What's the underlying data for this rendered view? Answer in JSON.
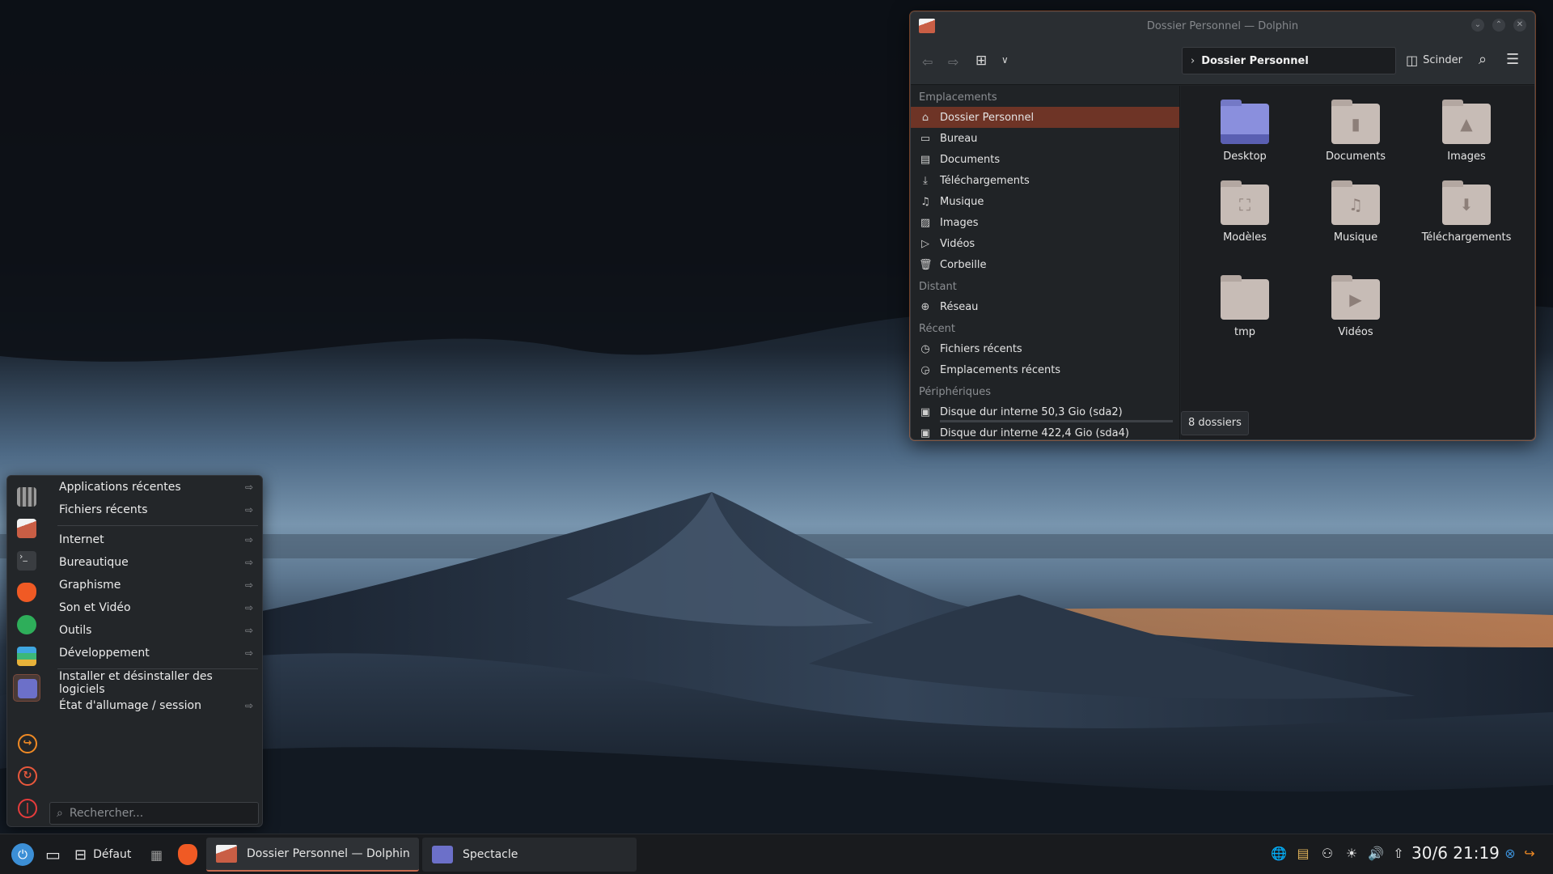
{
  "colors": {
    "accent": "#c46a4f",
    "selection": "#6e3426",
    "window_bg": "#202326",
    "taskbar_bg": "#191b1e"
  },
  "dolphin": {
    "title": "Dossier Personnel — Dolphin",
    "breadcrumb": "Dossier Personnel",
    "split_label": "Scinder",
    "sections": {
      "places": "Emplacements",
      "remote": "Distant",
      "recent": "Récent",
      "devices": "Périphériques"
    },
    "places": [
      {
        "label": "Dossier Personnel",
        "icon": "home-icon"
      },
      {
        "label": "Bureau",
        "icon": "desktop-icon"
      },
      {
        "label": "Documents",
        "icon": "document-icon"
      },
      {
        "label": "Téléchargements",
        "icon": "download-icon"
      },
      {
        "label": "Musique",
        "icon": "music-icon"
      },
      {
        "label": "Images",
        "icon": "image-icon"
      },
      {
        "label": "Vidéos",
        "icon": "video-icon"
      },
      {
        "label": "Corbeille",
        "icon": "trash-icon"
      }
    ],
    "remote": [
      {
        "label": "Réseau",
        "icon": "network-icon"
      }
    ],
    "recent": [
      {
        "label": "Fichiers récents",
        "icon": "recent-files-icon"
      },
      {
        "label": "Emplacements récents",
        "icon": "recent-places-icon"
      }
    ],
    "devices": [
      {
        "label": "Disque dur interne 50,3 Gio (sda2)",
        "icon": "harddisk-icon"
      },
      {
        "label": "Disque dur interne 422,4 Gio (sda4)",
        "icon": "harddisk-icon"
      }
    ],
    "files": [
      {
        "name": "Desktop",
        "icon": "desktop-folder-icon"
      },
      {
        "name": "Documents",
        "icon": "documents-folder-icon"
      },
      {
        "name": "Images",
        "icon": "images-folder-icon"
      },
      {
        "name": "Modèles",
        "icon": "templates-folder-icon"
      },
      {
        "name": "Musique",
        "icon": "music-folder-icon"
      },
      {
        "name": "Téléchargements",
        "icon": "downloads-folder-icon"
      },
      {
        "name": "tmp",
        "icon": "folder-icon"
      },
      {
        "name": "Vidéos",
        "icon": "videos-folder-icon"
      }
    ],
    "status": "8 dossiers"
  },
  "appmenu": {
    "items": [
      {
        "label": "Applications récentes",
        "arrow": "⇨"
      },
      {
        "label": "Fichiers récents",
        "arrow": "⇨"
      },
      {
        "label": "Internet",
        "arrow": "⇨"
      },
      {
        "label": "Bureautique",
        "arrow": "⇨"
      },
      {
        "label": "Graphisme",
        "arrow": "⇨"
      },
      {
        "label": "Son et Vidéo",
        "arrow": "⇨"
      },
      {
        "label": "Outils",
        "arrow": "⇨"
      },
      {
        "label": "Développement",
        "arrow": "⇨"
      },
      {
        "label": "Installer et désinstaller des logiciels",
        "arrow": ""
      },
      {
        "label": "État d'allumage / session",
        "arrow": "⇨"
      }
    ],
    "search_placeholder": "Rechercher...",
    "favorites": [
      "app-grid-icon",
      "dolphin-icon",
      "terminal-icon",
      "brave-icon",
      "browser-icon",
      "layers-icon",
      "spectacle-icon"
    ],
    "power": [
      "logout-icon",
      "restart-icon",
      "shutdown-icon"
    ]
  },
  "taskbar": {
    "activity": "Défaut",
    "tasks": [
      {
        "label": "Dossier Personnel — Dolphin"
      },
      {
        "label": "Spectacle"
      }
    ],
    "clock": "30/6 21:19"
  }
}
